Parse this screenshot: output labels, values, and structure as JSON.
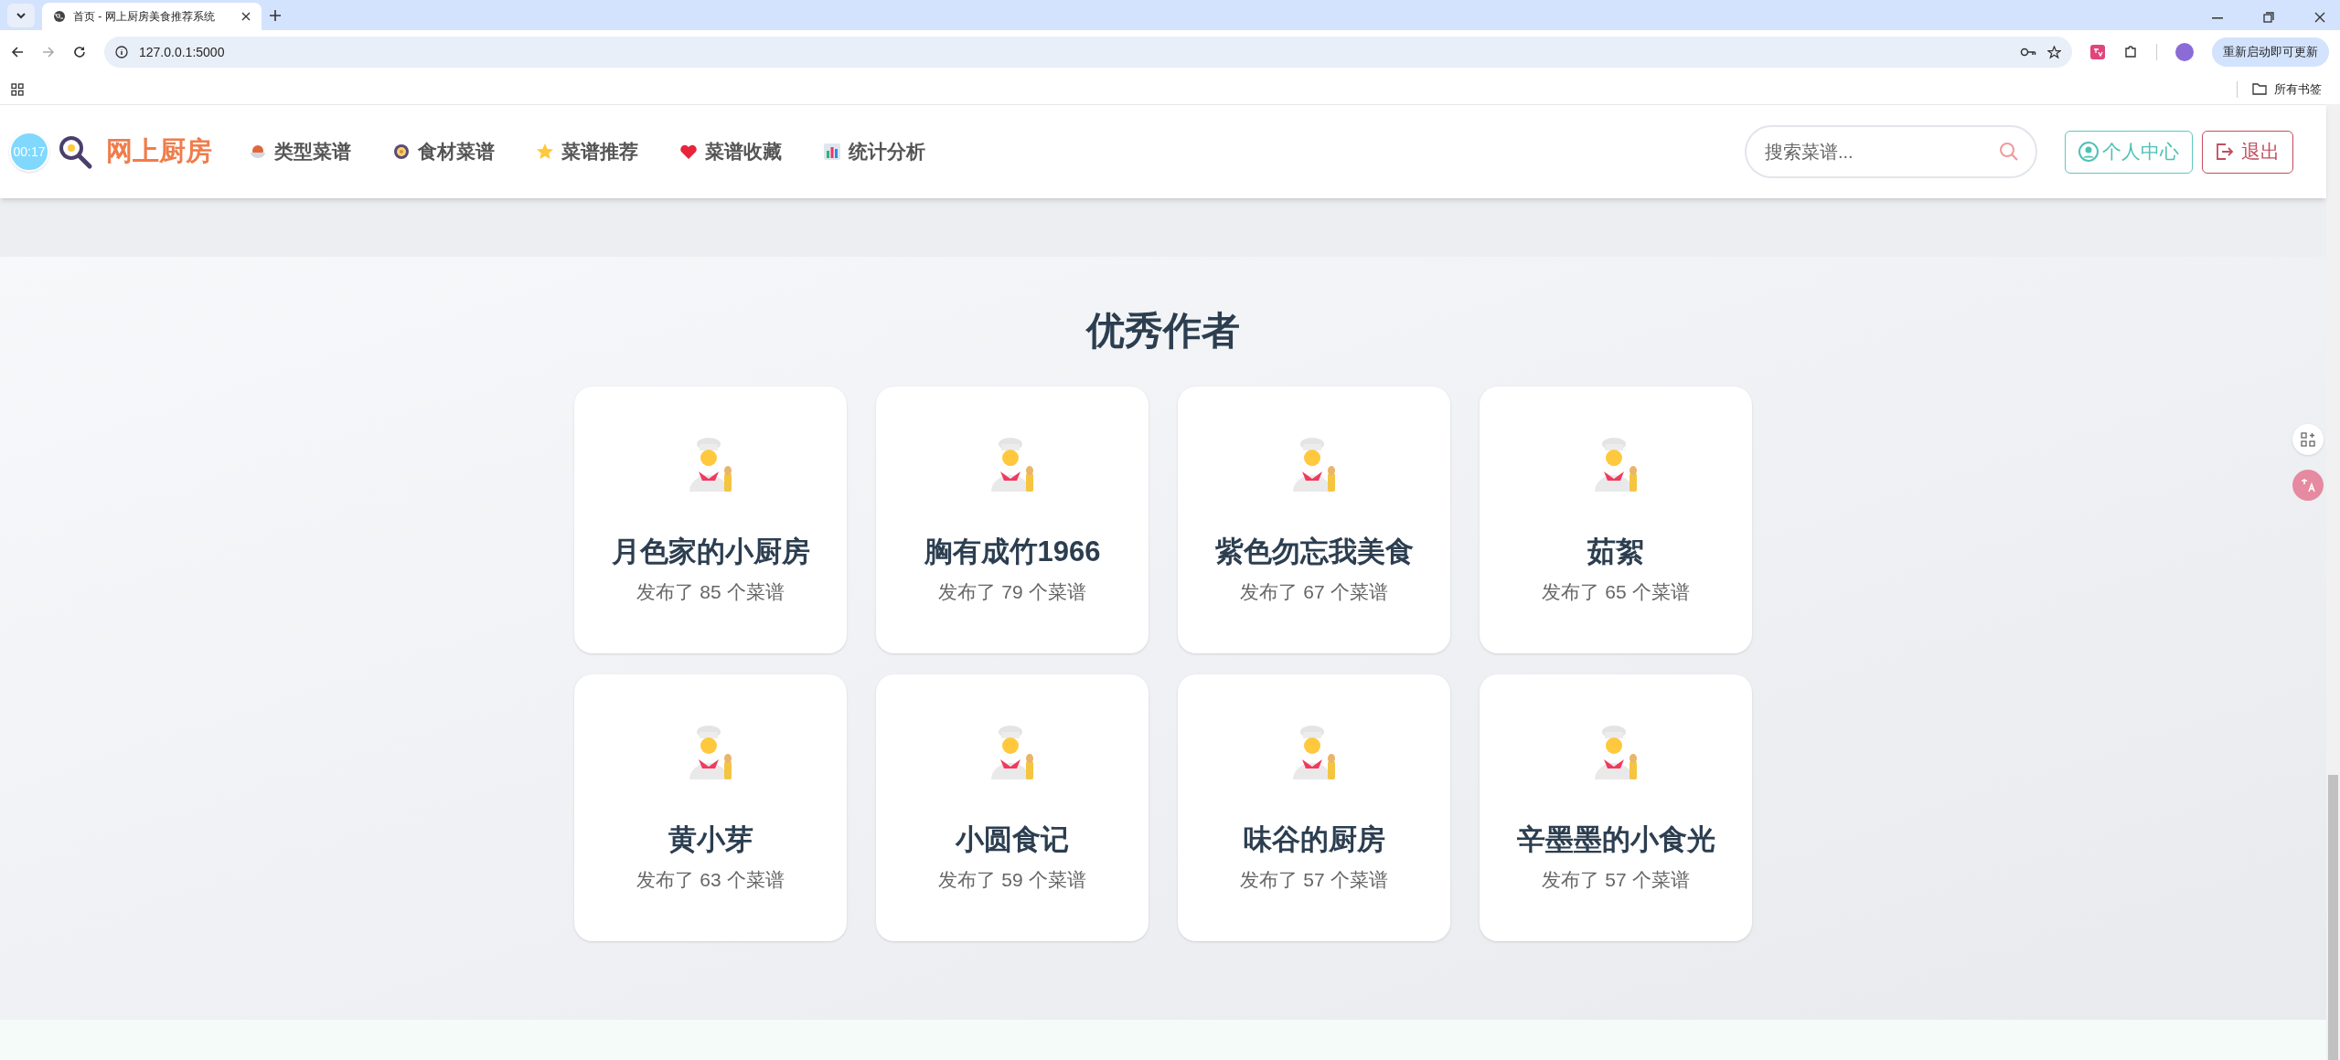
{
  "browser": {
    "tabs": [
      {
        "title": "首页 - 网上厨房美食推荐系统",
        "selected": true
      }
    ],
    "address": "127.0.0.1:5000",
    "update_button": "重新启动即可更新",
    "bookmarks_label": "所有书签"
  },
  "nav": {
    "timer": "00:17",
    "logo": "网上厨房",
    "items": [
      {
        "label": "类型菜谱"
      },
      {
        "label": "食材菜谱"
      },
      {
        "label": "菜谱推荐"
      },
      {
        "label": "菜谱收藏"
      },
      {
        "label": "统计分析"
      }
    ],
    "search": {
      "placeholder": "搜索菜谱..."
    },
    "profile_button": "个人中心",
    "logout_button": "退出"
  },
  "section": {
    "title": "优秀作者",
    "authors": [
      {
        "name": "月色家的小厨房",
        "count": "发布了 85 个菜谱"
      },
      {
        "name": "胸有成竹1966",
        "count": "发布了 79 个菜谱"
      },
      {
        "name": "紫色勿忘我美食",
        "count": "发布了 67 个菜谱"
      },
      {
        "name": "茹絮",
        "count": "发布了 65 个菜谱"
      },
      {
        "name": "黄小芽",
        "count": "发布了 63 个菜谱"
      },
      {
        "name": "小圆食记",
        "count": "发布了 59 个菜谱"
      },
      {
        "name": "味谷的厨房",
        "count": "发布了 57 个菜谱"
      },
      {
        "name": "辛墨墨的小食光",
        "count": "发布了 57 个菜谱"
      }
    ]
  }
}
